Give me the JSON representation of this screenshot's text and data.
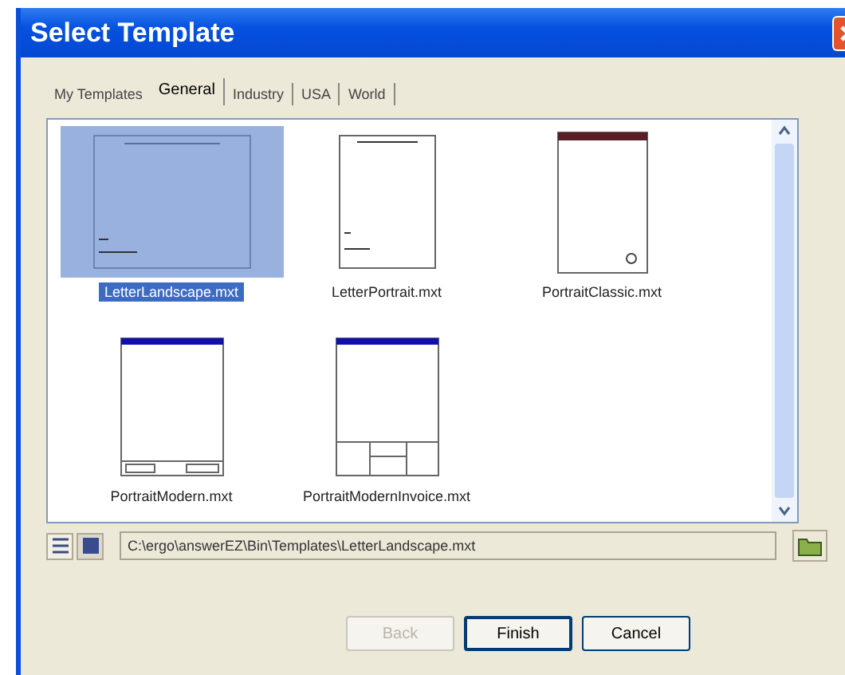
{
  "window": {
    "title": "Select Template"
  },
  "tabs": [
    {
      "label": "My Templates",
      "selected": false
    },
    {
      "label": "General",
      "selected": true
    },
    {
      "label": "Industry",
      "selected": false
    },
    {
      "label": "USA",
      "selected": false
    },
    {
      "label": "World",
      "selected": false
    }
  ],
  "templates": [
    {
      "name": "LetterLandscape.mxt",
      "kind": "landscape",
      "selected": true
    },
    {
      "name": "LetterPortrait.mxt",
      "kind": "letter",
      "selected": false
    },
    {
      "name": "PortraitClassic.mxt",
      "kind": "classic",
      "selected": false
    },
    {
      "name": "PortraitModern.mxt",
      "kind": "modern",
      "selected": false
    },
    {
      "name": "PortraitModernInvoice.mxt",
      "kind": "invoice",
      "selected": false
    }
  ],
  "path": "C:\\ergo\\answerEZ\\Bin\\Templates\\LetterLandscape.mxt",
  "buttons": [
    {
      "label": "Back",
      "disabled": true
    },
    {
      "label": "Finish",
      "disabled": false
    },
    {
      "label": "Cancel",
      "disabled": false
    }
  ]
}
